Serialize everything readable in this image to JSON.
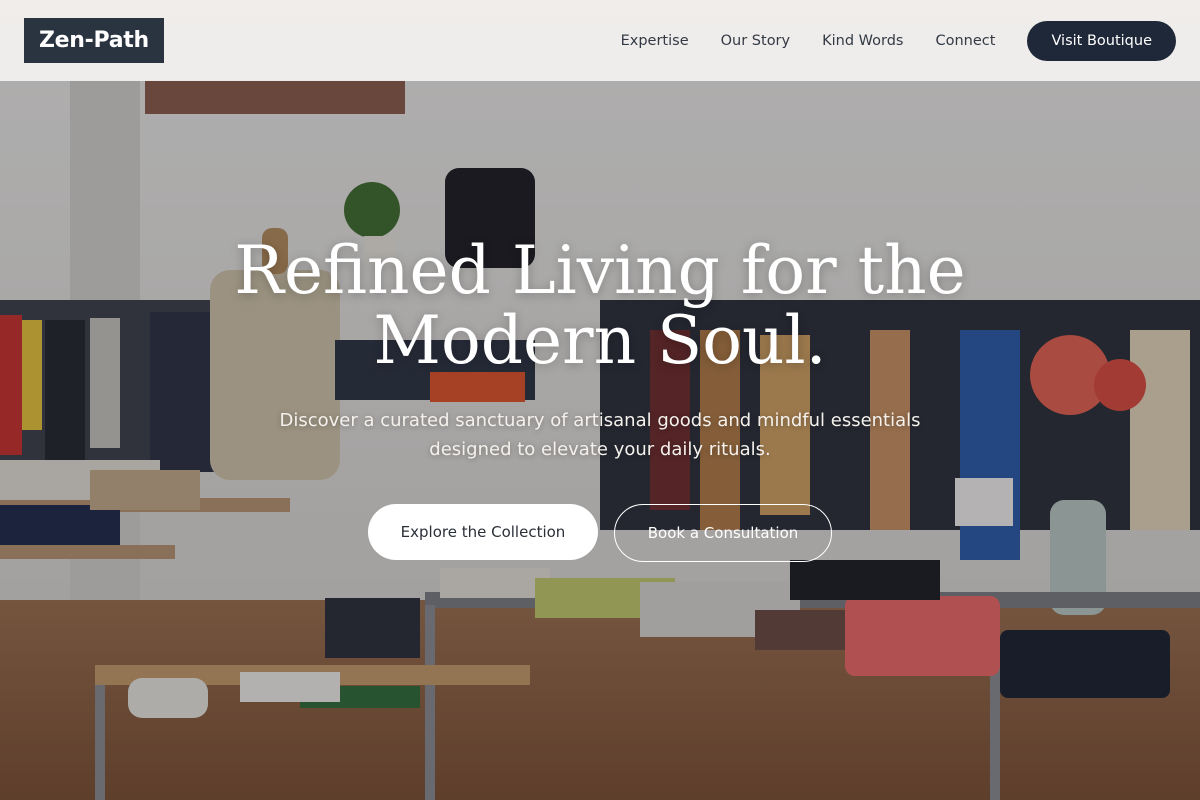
{
  "header": {
    "logo": "Zen-Path",
    "nav": [
      "Expertise",
      "Our Story",
      "Kind Words",
      "Connect"
    ],
    "cta": "Visit Boutique"
  },
  "hero": {
    "title_line1": "Refined Living for the",
    "title_line2": "Modern Soul.",
    "subtitle_line1": "Discover a curated sanctuary of artisanal goods and mindful essentials",
    "subtitle_line2": "designed to elevate your daily rituals.",
    "primary_button": "Explore the Collection",
    "secondary_button": "Book a Consultation",
    "background_image": "boutique-interior-photo"
  },
  "colors": {
    "brand_dark": "#1f2838",
    "logo_bg": "#2a3340",
    "header_bg": "#f4f2f0",
    "text_light": "#ffffff"
  }
}
